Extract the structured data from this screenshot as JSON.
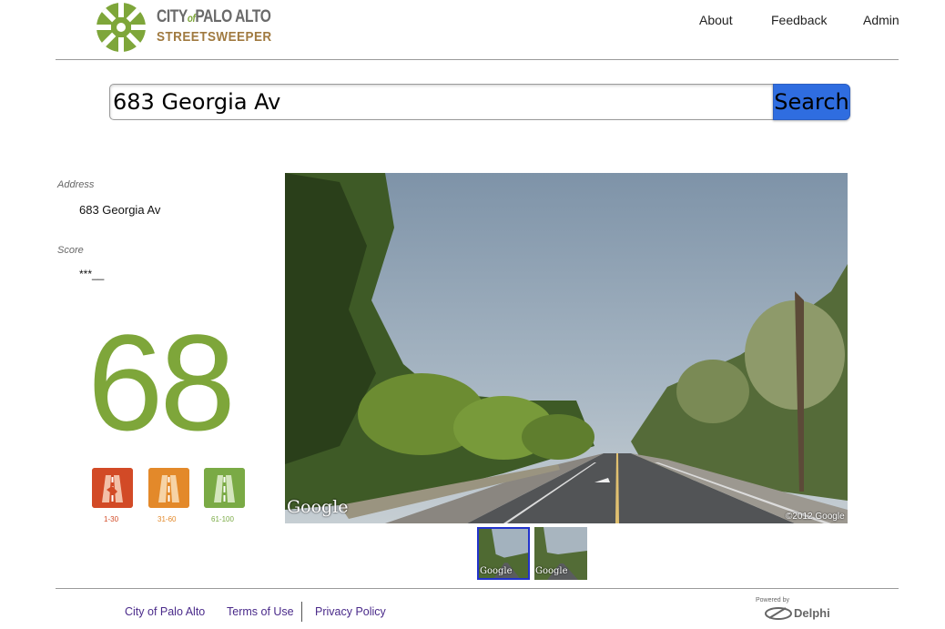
{
  "header": {
    "logo": {
      "line1_city": "CITY",
      "line1_of": "of",
      "line1_rest": "PALO ALTO",
      "line2": "STREETSWEEPER"
    },
    "nav": [
      "About",
      "Feedback",
      "Admin"
    ]
  },
  "search": {
    "value": "683 Georgia Av",
    "button_label": "Search"
  },
  "details": {
    "address_label": "Address",
    "address_value": "683 Georgia Av",
    "score_label": "Score",
    "score_value": "***__",
    "score_number": "68"
  },
  "legend": [
    {
      "range": "1-30",
      "color": "#d24a26"
    },
    {
      "range": "31-60",
      "color": "#e3892a"
    },
    {
      "range": "61-100",
      "color": "#7aaa45"
    }
  ],
  "streetview": {
    "watermark": "Google",
    "copyright": "©2012 Google"
  },
  "thumbnails": [
    {
      "watermark": "Google",
      "selected": true
    },
    {
      "watermark": "Google",
      "selected": false
    }
  ],
  "footer": {
    "links": [
      "City of Palo Alto",
      "Terms of Use",
      "Privacy Policy"
    ],
    "powered_by": "Powered by",
    "brand": "Delphi"
  },
  "colors": {
    "score_green": "#7ea63a",
    "search_button": "#2f6de0",
    "footer_link": "#4a2a8a"
  }
}
